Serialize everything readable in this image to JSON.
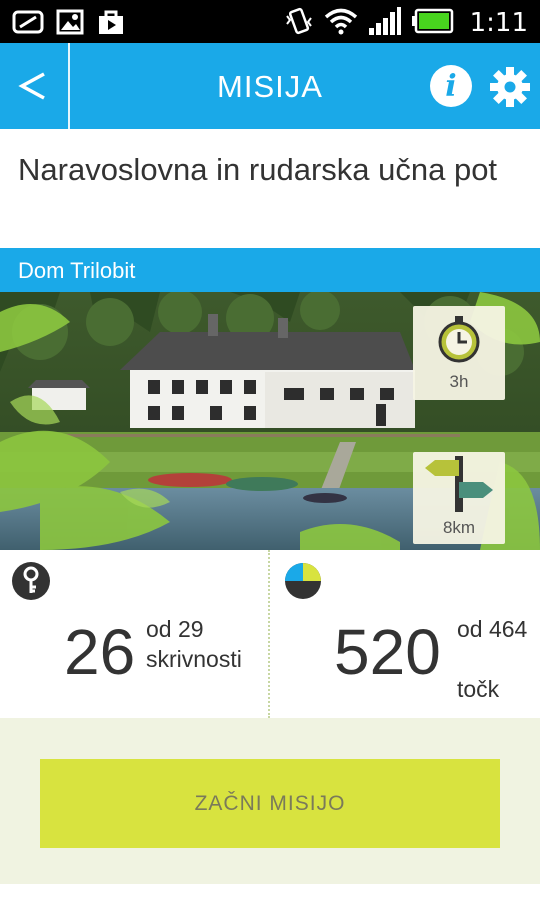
{
  "status_bar": {
    "time": "1:11",
    "icons_left": [
      "gallery-icon",
      "image-icon",
      "play-store-icon"
    ],
    "icons_right": [
      "vibrate-icon",
      "wifi-icon",
      "signal-icon",
      "battery-icon"
    ]
  },
  "action_bar": {
    "title": "MISIJA",
    "back_icon": "chevron-left-icon",
    "info_label": "i",
    "settings_icon": "gear-icon"
  },
  "mission": {
    "title": "Naravoslovna in rudarska učna pot",
    "location": "Dom Trilobit"
  },
  "photo": {
    "duration": "3h",
    "distance": "8km"
  },
  "stats": {
    "secrets_value": "26",
    "secrets_of": "od 29",
    "secrets_unit": "skrivnosti",
    "points_value": "520",
    "points_of": "od 464",
    "points_unit": "točk"
  },
  "footer": {
    "start_label": "ZAČNI MISIJO"
  },
  "colors": {
    "accent": "#1aa9e8",
    "button": "#d8e33f",
    "footer_bg": "#f0f3e1"
  }
}
